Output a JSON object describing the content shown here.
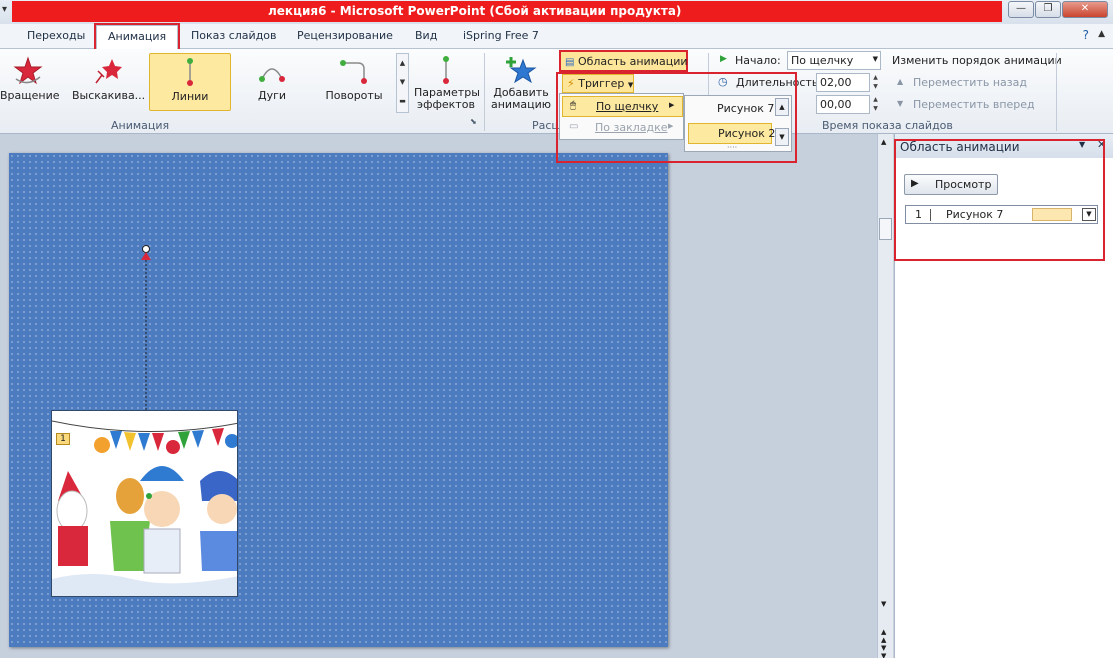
{
  "window": {
    "title": "лекция6 - Microsoft PowerPoint (Сбой активации продукта)"
  },
  "tabs": [
    {
      "label": "Переходы"
    },
    {
      "label": "Анимация"
    },
    {
      "label": "Показ слайдов"
    },
    {
      "label": "Рецензирование"
    },
    {
      "label": "Вид"
    },
    {
      "label": "iSpring Free 7"
    }
  ],
  "ribbon": {
    "effects": [
      {
        "label": "Вращение",
        "icon": "spin-star-icon"
      },
      {
        "label": "Выскакива...",
        "icon": "bounce-star-icon"
      },
      {
        "label": "Линии",
        "icon": "lines-path-icon"
      },
      {
        "label": "Дуги",
        "icon": "arcs-path-icon"
      },
      {
        "label": "Повороты",
        "icon": "turns-path-icon"
      }
    ],
    "effect_params_label_1": "Параметры",
    "effect_params_label_2": "эффектов",
    "add_anim_label_1": "Добавить",
    "add_anim_label_2": "анимацию",
    "group_animation_label": "Анимация",
    "group_ext_label": "Расш",
    "anim_pane_button": "Область анимации",
    "trigger_button": "Триггер",
    "start_label": "Начало:",
    "start_value": "По щелчку",
    "duration_label": "Длительность:",
    "duration_value": "02,00",
    "delay_value": "00,00",
    "reorder_label": "Изменить порядок анимации",
    "move_back": "Переместить назад",
    "move_forward": "Переместить вперед",
    "group_timing_label": "Время показа слайдов",
    "accent_color": "#d9232e"
  },
  "trigger_menu": {
    "items": [
      {
        "label": "По щелчку",
        "state": "highlighted"
      },
      {
        "label": "По закладке",
        "state": "disabled"
      }
    ],
    "submenu": [
      {
        "label": "Рисунок 7"
      },
      {
        "label": "Рисунок 2",
        "state": "highlighted"
      }
    ]
  },
  "pane": {
    "title": "Область анимации",
    "preview_button": "Просмотр",
    "items": [
      {
        "number": "1",
        "name": "Рисунок 7"
      }
    ]
  },
  "slide": {
    "anim_tag": "1",
    "background_color": "#4d7bc0"
  }
}
